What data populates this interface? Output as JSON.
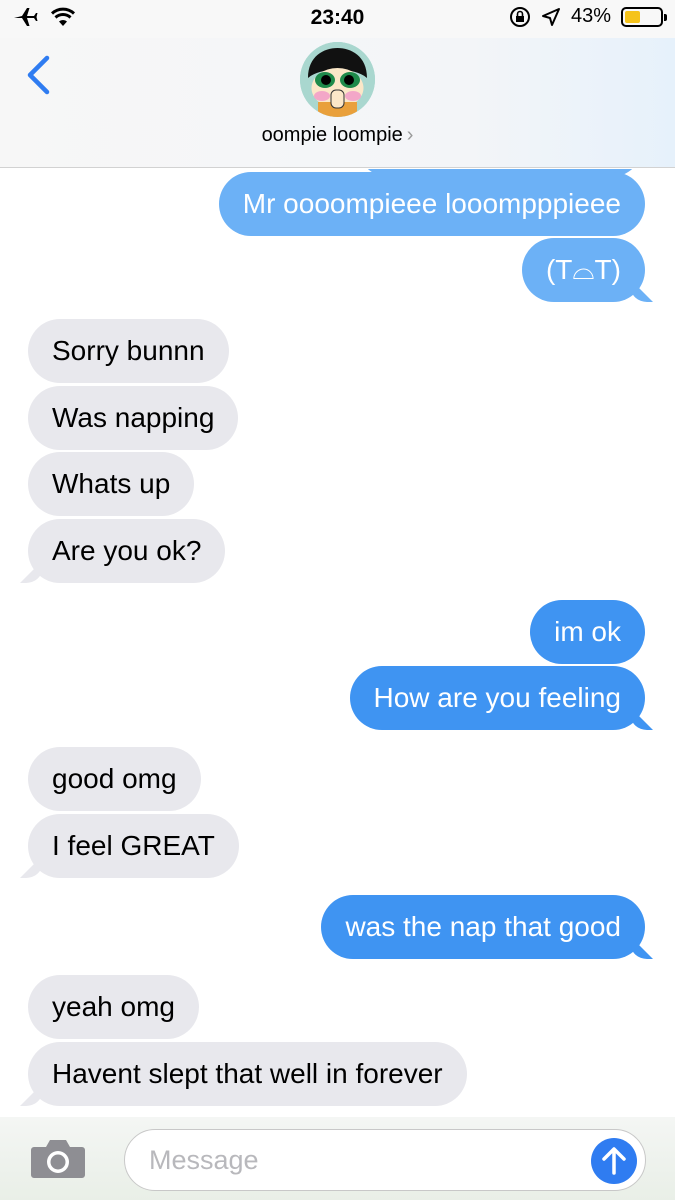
{
  "status_bar": {
    "time": "23:40",
    "battery_percent_label": "43%",
    "battery_level": 0.43,
    "icons": [
      "airplane-icon",
      "wifi-icon",
      "orientation-lock-icon",
      "location-arrow-icon",
      "battery-icon"
    ]
  },
  "header": {
    "contact_name": "oompie loompie",
    "chevron": "›",
    "back_icon": "chevron-left-icon"
  },
  "messages": [
    {
      "direction": "outgoing",
      "text": "Mr oooompieee looompppieee"
    },
    {
      "direction": "outgoing",
      "text": "(T⌓T)"
    },
    {
      "direction": "incoming",
      "text": "Sorry bunnn"
    },
    {
      "direction": "incoming",
      "text": "Was napping"
    },
    {
      "direction": "incoming",
      "text": "Whats up"
    },
    {
      "direction": "incoming",
      "text": "Are you ok?"
    },
    {
      "direction": "outgoing",
      "text": "im ok"
    },
    {
      "direction": "outgoing",
      "text": "How are you feeling"
    },
    {
      "direction": "incoming",
      "text": "good omg"
    },
    {
      "direction": "incoming",
      "text": "I feel GREAT"
    },
    {
      "direction": "outgoing",
      "text": "was the nap that good"
    },
    {
      "direction": "incoming",
      "text": "yeah omg"
    },
    {
      "direction": "incoming",
      "text": "Havent slept that well in forever"
    }
  ],
  "composer": {
    "placeholder": "Message",
    "value": "",
    "camera_icon": "camera-icon",
    "send_icon": "send-arrow-icon"
  },
  "colors": {
    "outgoing_bubble": "#3f94f2",
    "incoming_bubble": "#e8e8ed",
    "accent": "#2f7cf1",
    "battery_fill": "#f5c31b"
  }
}
